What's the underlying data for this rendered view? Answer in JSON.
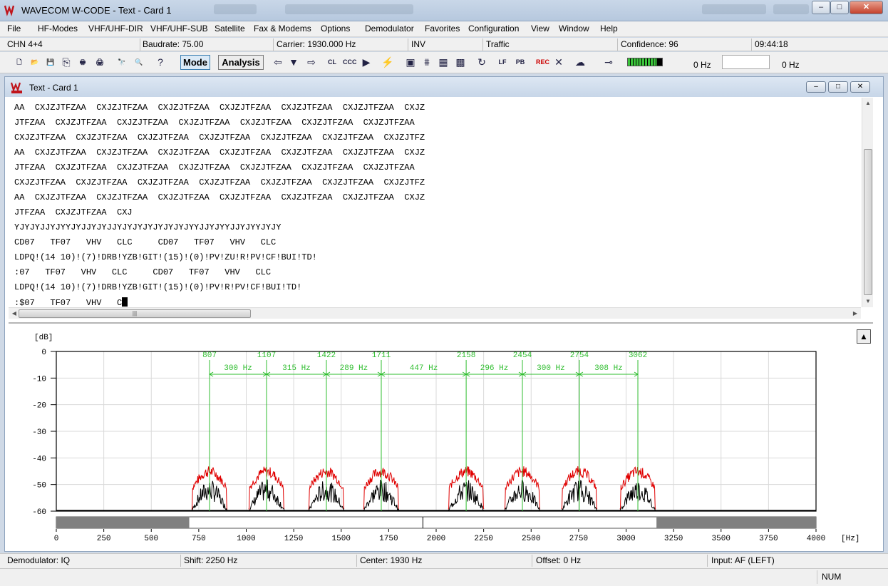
{
  "window": {
    "title": "WAVECOM W-CODE - Text  - Card 1",
    "minimize_glyph": "–",
    "maximize_glyph": "□",
    "close_glyph": "✕"
  },
  "menu": [
    {
      "label": "File"
    },
    {
      "label": "HF-Modes"
    },
    {
      "label": "VHF/UHF-DIR"
    },
    {
      "label": "VHF/UHF-SUB"
    },
    {
      "label": "Satellite"
    },
    {
      "label": "Fax & Modems"
    },
    {
      "label": "Options"
    },
    {
      "label": "Demodulator"
    },
    {
      "label": "Favorites"
    },
    {
      "label": "Configuration"
    },
    {
      "label": "View"
    },
    {
      "label": "Window"
    },
    {
      "label": "Help"
    }
  ],
  "status_top": {
    "channel": "CHN 4+4",
    "baudrate": "Baudrate: 75.00",
    "carrier": "Carrier: 1930.000 Hz",
    "polarity": "INV",
    "state": "Traffic",
    "confidence": "Confidence: 96",
    "time": "09:44:18"
  },
  "toolbar": {
    "mode_label": "Mode",
    "analysis_label": "Analysis",
    "readout_left": "0 Hz",
    "readout_right": "0 Hz",
    "level_fraction": 0.85,
    "icons": [
      "new-icon",
      "open-icon",
      "save-icon",
      "copy-icon",
      "print-icon",
      "print-preview-icon",
      "find-icon",
      "find-next-icon",
      "help-icon",
      "arrow-left-icon",
      "dropdown-icon",
      "arrow-right-icon",
      "clear-icon",
      "clear-all-icon",
      "play-icon",
      "tune-icon",
      "modem-icon",
      "antenna-icon",
      "grid-icon",
      "pattern-icon",
      "sync-icon",
      "lcf-icon",
      "pb-icon",
      "record-icon",
      "mute-icon",
      "cloud-icon",
      "line-icon"
    ],
    "icon_glyphs": [
      "🗋",
      "📂",
      "💾",
      "⎘",
      "🖶",
      "🖨",
      "🔭",
      "🔍",
      "?",
      "⇦",
      "▼",
      "⇨",
      "CL",
      "CCC",
      "▶",
      "⚡",
      "▣",
      "⩩",
      "▦",
      "▩",
      "↻",
      "LF",
      "PB",
      "REC",
      "✕",
      "☁",
      "⊸"
    ]
  },
  "child": {
    "title": "Text  - Card 1"
  },
  "text_lines": [
    "AA  CXJZJTFZAA  CXJZJTFZAA  CXJZJTFZAA  CXJZJTFZAA  CXJZJTFZAA  CXJZJTFZAA  CXJZ",
    "JTFZAA  CXJZJTFZAA  CXJZJTFZAA  CXJZJTFZAA  CXJZJTFZAA  CXJZJTFZAA  CXJZJTFZAA",
    "CXJZJTFZAA  CXJZJTFZAA  CXJZJTFZAA  CXJZJTFZAA  CXJZJTFZAA  CXJZJTFZAA  CXJZJTFZ",
    "AA  CXJZJTFZAA  CXJZJTFZAA  CXJZJTFZAA  CXJZJTFZAA  CXJZJTFZAA  CXJZJTFZAA  CXJZ",
    "JTFZAA  CXJZJTFZAA  CXJZJTFZAA  CXJZJTFZAA  CXJZJTFZAA  CXJZJTFZAA  CXJZJTFZAA",
    "CXJZJTFZAA  CXJZJTFZAA  CXJZJTFZAA  CXJZJTFZAA  CXJZJTFZAA  CXJZJTFZAA  CXJZJTFZ",
    "AA  CXJZJTFZAA  CXJZJTFZAA  CXJZJTFZAA  CXJZJTFZAA  CXJZJTFZAA  CXJZJTFZAA  CXJZ",
    "JTFZAA  CXJZJTFZAA  CXJ",
    "YJYJYJJYJYYJYJJYJYJJYJYJYJYJYJYJYJYYJJYJYYJJYJYYJYJY",
    "CD07   TF07   VHV   CLC     CD07   TF07   VHV   CLC",
    "LDPQ!(14 10)!(7)!DRB!YZB!GIT!(15)!(0)!PV!ZU!R!PV!CF!BUI!TD!",
    ":07   TF07   VHV   CLC     CD07   TF07   VHV   CLC",
    "LDPQ!(14 10)!(7)!DRB!YZB!GIT!(15)!(0)!PV!R!PV!CF!BUI!TD!",
    ":$07   TF07   VHV   C"
  ],
  "chart_data": {
    "type": "line",
    "title": "",
    "ylabel": "[dB]",
    "xlabel": "[Hz]",
    "xlim": [
      0,
      4000
    ],
    "ylim": [
      -60,
      0
    ],
    "x_ticks": [
      0,
      250,
      500,
      750,
      1000,
      1250,
      1500,
      1750,
      2000,
      2250,
      2500,
      2750,
      3000,
      3250,
      3500,
      3750,
      4000
    ],
    "y_ticks": [
      0,
      -10,
      -20,
      -30,
      -40,
      -50,
      -60
    ],
    "grid": true,
    "markers": [
      807,
      1107,
      1422,
      1711,
      2158,
      2454,
      2754,
      3062
    ],
    "spacings": [
      {
        "from": 807,
        "to": 1107,
        "label": "300 Hz"
      },
      {
        "from": 1107,
        "to": 1422,
        "label": "315 Hz"
      },
      {
        "from": 1422,
        "to": 1711,
        "label": "289 Hz"
      },
      {
        "from": 1711,
        "to": 2158,
        "label": "447 Hz"
      },
      {
        "from": 2158,
        "to": 2454,
        "label": "296 Hz"
      },
      {
        "from": 2454,
        "to": 2754,
        "label": "300 Hz"
      },
      {
        "from": 2754,
        "to": 3062,
        "label": "308 Hz"
      }
    ],
    "peak_db_max": -43,
    "peak_db_avg": -48,
    "floor_db": -60,
    "tone_halfwidth_hz": 95,
    "passband": [
      700,
      3160
    ],
    "center_marker": 1930,
    "colors": {
      "max": "#e00000",
      "avg": "#000000",
      "marker": "#2ebd2e",
      "grid": "#d9d9d9",
      "band_bar": "#808080"
    }
  },
  "status_bottom": {
    "demodulator": "Demodulator: IQ",
    "shift": "Shift: 2250 Hz",
    "center": "Center: 1930 Hz",
    "offset": "Offset: 0 Hz",
    "input": "Input: AF (LEFT)",
    "num": "NUM"
  }
}
